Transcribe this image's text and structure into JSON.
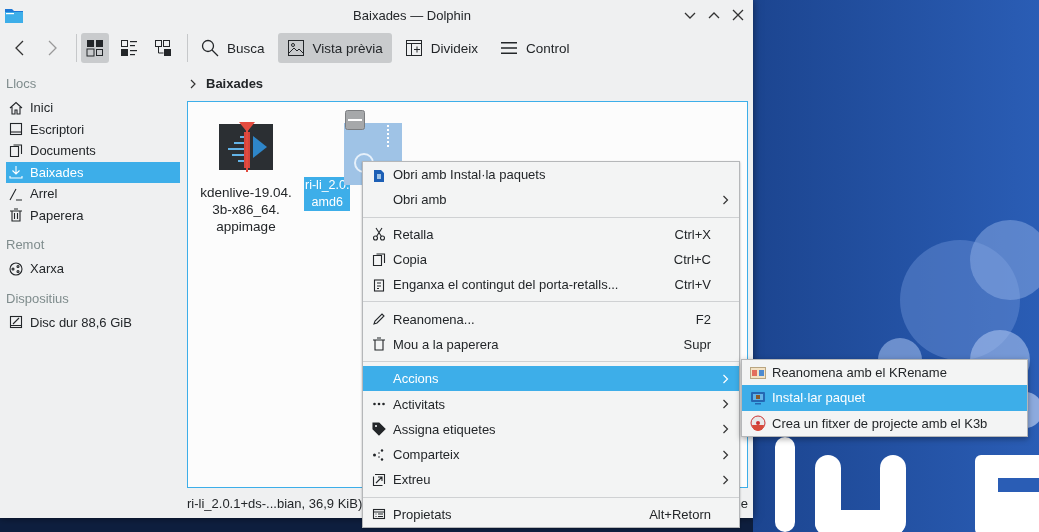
{
  "window": {
    "title": "Baixades — Dolphin"
  },
  "toolbar": {
    "view_modes": [
      {
        "selected": true
      },
      {
        "selected": false
      },
      {
        "selected": false
      }
    ],
    "buttons": [
      {
        "label": "Busca",
        "checked": false
      },
      {
        "label": "Vista prèvia",
        "checked": true
      },
      {
        "label": "Divideix",
        "checked": false
      },
      {
        "label": "Control",
        "checked": false
      }
    ]
  },
  "sidebar": {
    "sections": [
      {
        "title": "Llocs",
        "items": [
          {
            "label": "Inici",
            "selected": false
          },
          {
            "label": "Escriptori",
            "selected": false
          },
          {
            "label": "Documents",
            "selected": false
          },
          {
            "label": "Baixades",
            "selected": true
          },
          {
            "label": "Arrel",
            "selected": false
          },
          {
            "label": "Paperera",
            "selected": false
          }
        ]
      },
      {
        "title": "Remot",
        "items": [
          {
            "label": "Xarxa",
            "selected": false
          }
        ]
      },
      {
        "title": "Dispositius",
        "items": [
          {
            "label": "Disc dur 88,6 GiB",
            "selected": false
          }
        ]
      }
    ]
  },
  "breadcrumb": "Baixades",
  "files": [
    {
      "name_lines": [
        "kdenlive-19.04.",
        "3b-x86_64.",
        "appimage"
      ],
      "selected": false
    },
    {
      "name_lines": [
        "ri-li_2.0.",
        "amd6"
      ],
      "selected": true
    }
  ],
  "status_bar": {
    "text": "ri-li_2.0.1+ds-...bian, 36,9 KiB)",
    "tail": "e"
  },
  "context_menu": {
    "items": [
      {
        "kind": "item",
        "label": "Obri amb Instal·la paquets",
        "submenu": false,
        "selected": false
      },
      {
        "kind": "item",
        "label": "Obri amb",
        "submenu": true,
        "selected": false
      },
      {
        "kind": "separator"
      },
      {
        "kind": "item",
        "label": "Retalla",
        "shortcut": "Ctrl+X",
        "submenu": false,
        "selected": false
      },
      {
        "kind": "item",
        "label": "Copia",
        "shortcut": "Ctrl+C",
        "submenu": false,
        "selected": false
      },
      {
        "kind": "item",
        "label": "Enganxa el contingut del porta-retalls...",
        "shortcut": "Ctrl+V",
        "submenu": false,
        "selected": false
      },
      {
        "kind": "separator"
      },
      {
        "kind": "item",
        "label": "Reanomena...",
        "shortcut": "F2",
        "submenu": false,
        "selected": false
      },
      {
        "kind": "item",
        "label": "Mou a la paperera",
        "shortcut": "Supr",
        "submenu": false,
        "selected": false
      },
      {
        "kind": "separator"
      },
      {
        "kind": "item",
        "label": "Accions",
        "submenu": true,
        "selected": true
      },
      {
        "kind": "item",
        "label": "Activitats",
        "submenu": true,
        "selected": false
      },
      {
        "kind": "item",
        "label": "Assigna etiquetes",
        "submenu": true,
        "selected": false
      },
      {
        "kind": "item",
        "label": "Comparteix",
        "submenu": true,
        "selected": false
      },
      {
        "kind": "item",
        "label": "Extreu",
        "submenu": true,
        "selected": false
      },
      {
        "kind": "separator"
      },
      {
        "kind": "item",
        "label": "Propietats",
        "shortcut": "Alt+Retorn",
        "submenu": false,
        "selected": false
      }
    ]
  },
  "submenu": {
    "items": [
      {
        "label": "Reanomena amb el KRename",
        "selected": false
      },
      {
        "label": "Instal·lar paquet",
        "selected": true
      },
      {
        "label": "Crea un fitxer de projecte amb el K3b",
        "selected": false
      }
    ]
  }
}
